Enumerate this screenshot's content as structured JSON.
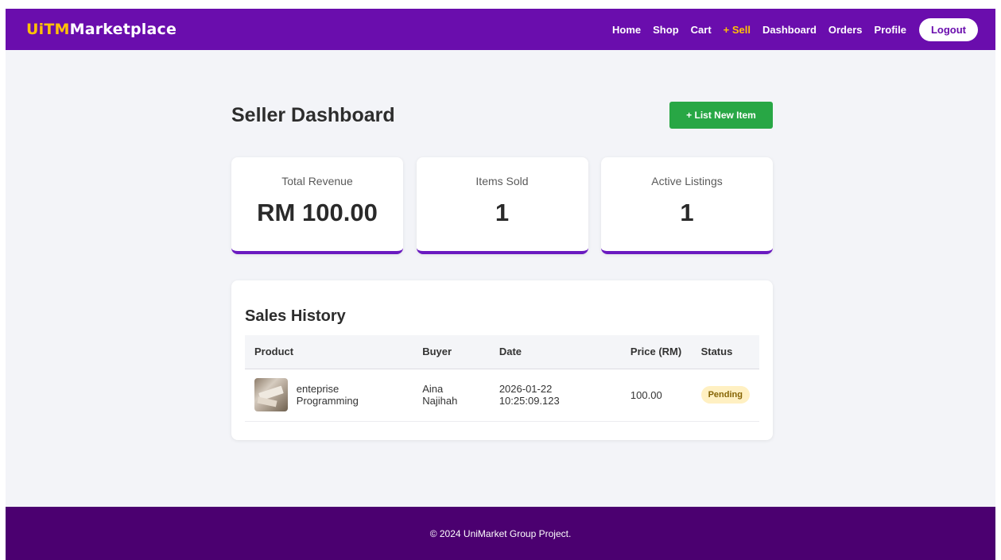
{
  "navbar": {
    "brand_part1": "UiTM",
    "brand_part2": "Marketplace",
    "links": [
      "Home",
      "Shop",
      "Cart",
      "+ Sell",
      "Dashboard",
      "Orders",
      "Profile"
    ],
    "logout_label": "Logout"
  },
  "page": {
    "title": "Seller Dashboard",
    "list_button_label": "+ List New Item"
  },
  "stats": [
    {
      "label": "Total Revenue",
      "value": "RM 100.00"
    },
    {
      "label": "Items Sold",
      "value": "1"
    },
    {
      "label": "Active Listings",
      "value": "1"
    }
  ],
  "sales": {
    "title": "Sales History",
    "columns": [
      "Product",
      "Buyer",
      "Date",
      "Price (RM)",
      "Status"
    ],
    "rows": [
      {
        "product": "enteprise Programming",
        "buyer": "Aina Najihah",
        "date": "2026-01-22 10:25:09.123",
        "price": "100.00",
        "status": "Pending"
      }
    ]
  },
  "footer": {
    "text": "© 2024 UniMarket Group Project."
  },
  "colors": {
    "primary": "#6a0dad",
    "accent": "#ffc107",
    "success": "#28a745",
    "footer": "#4b0070",
    "pending_badge": "#fff0c2"
  }
}
